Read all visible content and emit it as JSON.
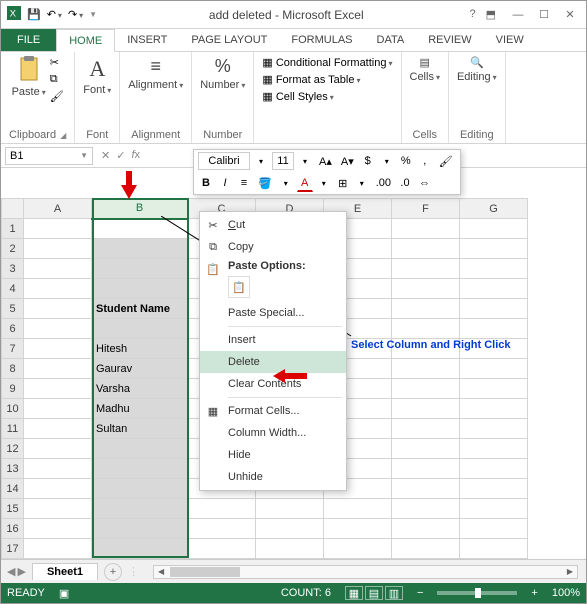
{
  "window": {
    "title": "add deleted - Microsoft Excel"
  },
  "tabs": {
    "file": "FILE",
    "home": "HOME",
    "insert": "INSERT",
    "page": "PAGE LAYOUT",
    "formulas": "FORMULAS",
    "data": "DATA",
    "review": "REVIEW",
    "view": "VIEW"
  },
  "ribbon": {
    "clipboard": {
      "label": "Clipboard",
      "paste": "Paste"
    },
    "font": {
      "label": "Font",
      "btn": "Font"
    },
    "alignment": {
      "label": "Alignment",
      "btn": "Alignment"
    },
    "number": {
      "label": "Number",
      "btn": "Number"
    },
    "styles": {
      "cond": "Conditional Formatting",
      "table": "Format as Table",
      "cell": "Cell Styles"
    },
    "cells": {
      "label": "Cells",
      "btn": "Cells"
    },
    "editing": {
      "label": "Editing",
      "btn": "Editing"
    }
  },
  "namebox": "B1",
  "mini": {
    "font": "Calibri",
    "size": "11",
    "bold": "B",
    "italic": "I"
  },
  "columns": [
    "A",
    "B",
    "C",
    "D",
    "E",
    "F",
    "G"
  ],
  "cells": {
    "b5": "Student Name",
    "b7": "Hitesh",
    "b8": "Gaurav",
    "b9": "Varsha",
    "b10": "Madhu",
    "b11": "Sultan"
  },
  "ctx": {
    "cut": "Cut",
    "copy": "Copy",
    "pastehdr": "Paste Options:",
    "pastespecial": "Paste Special...",
    "insert": "Insert",
    "delete": "Delete",
    "clear": "Clear Contents",
    "format": "Format Cells...",
    "colw": "Column Width...",
    "hide": "Hide",
    "unhide": "Unhide"
  },
  "annotation": "Select Column and Right Click",
  "sheet": {
    "name": "Sheet1"
  },
  "status": {
    "ready": "READY",
    "count_lbl": "COUNT:",
    "count": "6",
    "zoom": "100%"
  }
}
